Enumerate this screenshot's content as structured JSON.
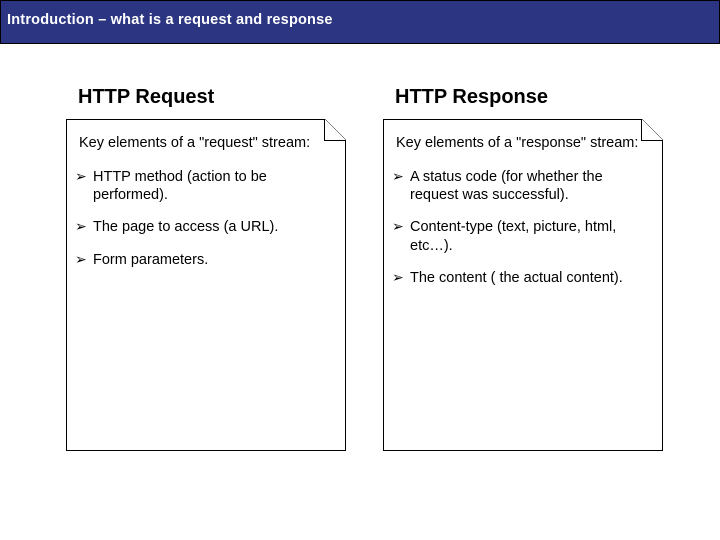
{
  "header": {
    "title": "Introduction – what is a request and response"
  },
  "columns": {
    "left": {
      "title": "HTTP Request",
      "intro": "Key elements of a \"request\" stream:",
      "bullets": [
        "HTTP method (action to be performed).",
        "The page to access (a URL).",
        "Form parameters."
      ]
    },
    "right": {
      "title": "HTTP Response",
      "intro": "Key elements of a \"response\" stream:",
      "bullets": [
        "A status code (for whether the request was successful).",
        "Content-type (text, picture, html, etc…).",
        "The content ( the actual content)."
      ]
    }
  }
}
